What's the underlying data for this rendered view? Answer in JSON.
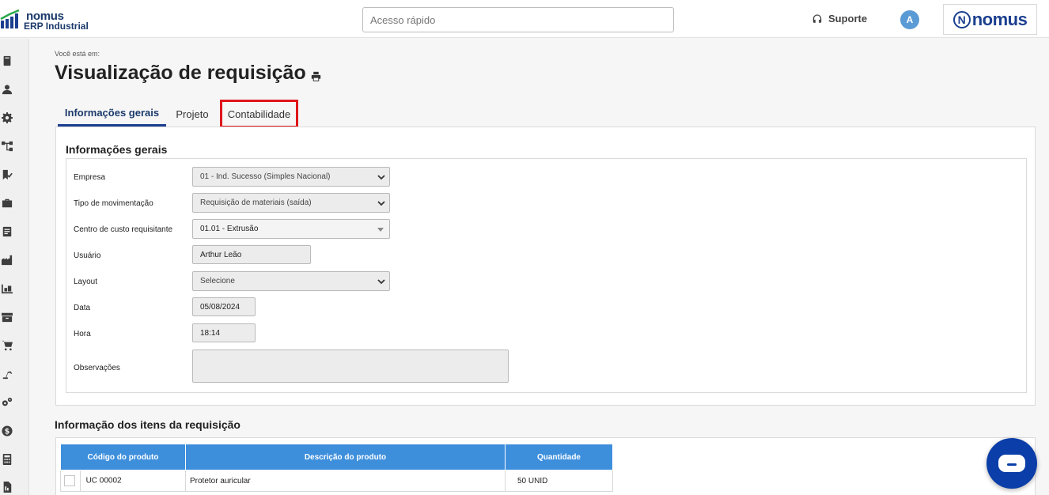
{
  "header": {
    "logo_line1": "nomus",
    "logo_line2": "ERP Industrial",
    "search_placeholder": "Acesso rápido",
    "support_label": "Suporte",
    "avatar_initial": "A",
    "brand_text": "nomus",
    "brand_letter": "N"
  },
  "sidebar": {
    "icons": [
      "book-icon",
      "user-icon",
      "gear-icon",
      "org-chart-icon",
      "flag-check-icon",
      "briefcase-icon",
      "invoice-icon",
      "factory-icon",
      "warehouse-icon",
      "archive-box-icon",
      "cart-icon",
      "robot-arm-icon",
      "gears-icon",
      "dollar-icon",
      "calculator-icon",
      "report-icon"
    ]
  },
  "page": {
    "breadcrumb": "Você está em:",
    "title": "Visualização de requisição"
  },
  "tabs": [
    {
      "label": "Informações gerais",
      "active": true
    },
    {
      "label": "Projeto",
      "active": false
    },
    {
      "label": "Contabilidade",
      "active": false,
      "highlighted": true
    }
  ],
  "form": {
    "section_title": "Informações gerais",
    "fields": {
      "empresa": {
        "label": "Empresa",
        "value": "01 - Ind. Sucesso (Simples Nacional)"
      },
      "tipo": {
        "label": "Tipo de movimentação",
        "value": "Requisição de materiais (saída)"
      },
      "centro": {
        "label": "Centro de custo requisitante",
        "value": "01.01 - Extrusão"
      },
      "usuario": {
        "label": "Usuário",
        "value": "Arthur Leão"
      },
      "layout": {
        "label": "Layout",
        "value": "Selecione"
      },
      "data": {
        "label": "Data",
        "value": "05/08/2024"
      },
      "hora": {
        "label": "Hora",
        "value": "18:14"
      },
      "obs": {
        "label": "Observações",
        "value": ""
      }
    }
  },
  "items": {
    "section_title": "Informação dos itens da requisição",
    "columns": [
      "Código do produto",
      "Descrição do produto",
      "Quantidade"
    ],
    "rows": [
      {
        "codigo": "UC 00002",
        "descricao": "Protetor auricular",
        "quantidade": "50 UNID"
      }
    ]
  },
  "colors": {
    "accent": "#1b3f8f",
    "table_header": "#3d8fdc",
    "highlight": "#e0161b",
    "chat": "#0b3ea8"
  }
}
